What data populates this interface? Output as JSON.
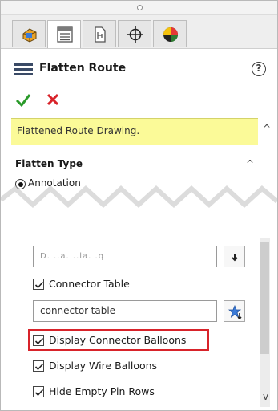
{
  "panel": {
    "title": "Flatten Route",
    "help": "?"
  },
  "tabs": [
    {
      "name": "feature-manager-tab",
      "active": false
    },
    {
      "name": "property-manager-tab",
      "active": true
    },
    {
      "name": "configuration-manager-tab",
      "active": false
    },
    {
      "name": "dimxpert-manager-tab",
      "active": false
    },
    {
      "name": "display-manager-tab",
      "active": false
    }
  ],
  "actions": {
    "ok": "✔",
    "cancel": "✖"
  },
  "message": "Flattened Route Drawing.",
  "flatten_type": {
    "title": "Flatten Type",
    "option": "Annotation",
    "selected": true
  },
  "drawing_field": {
    "value": "D. ..a. ..la. .q"
  },
  "connector_table": {
    "label": "Connector Table",
    "checked": true,
    "template_value": "connector-table"
  },
  "options": [
    {
      "label": "Display Connector Balloons",
      "checked": true,
      "highlighted": true
    },
    {
      "label": "Display Wire Balloons",
      "checked": true,
      "highlighted": false
    },
    {
      "label": "Hide Empty Pin Rows",
      "checked": true,
      "highlighted": false
    }
  ],
  "colors": {
    "message_bg": "#fbfa98",
    "highlight": "#d8232a",
    "ok": "#2a9a2a",
    "cancel": "#d8232a"
  }
}
